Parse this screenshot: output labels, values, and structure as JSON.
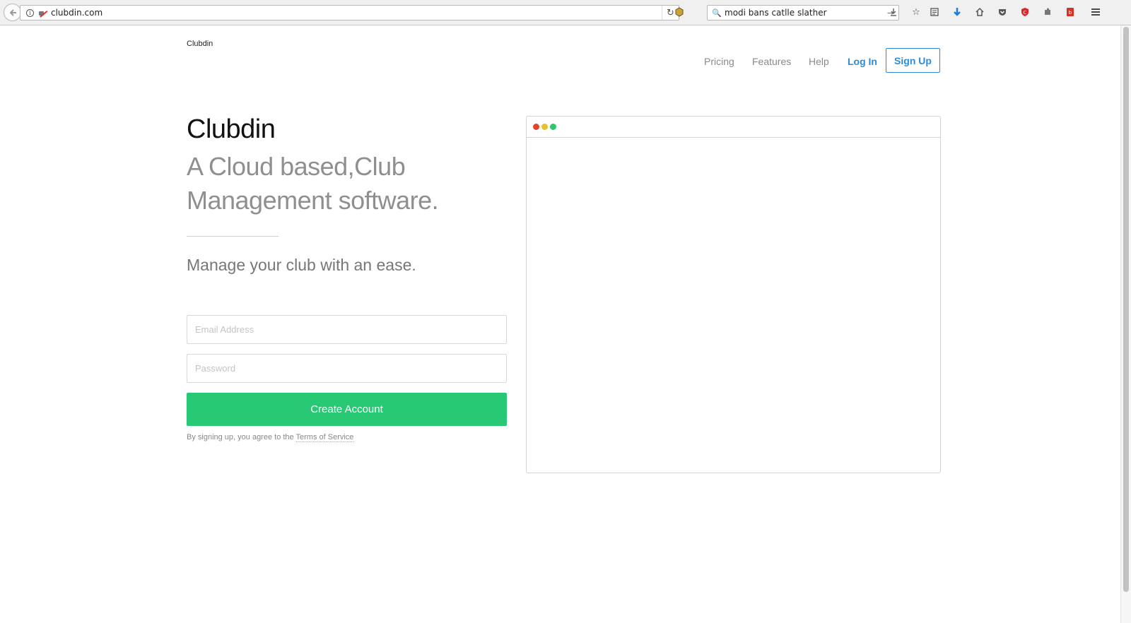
{
  "browser": {
    "url": "clubdin.com",
    "search_query": "modi bans catlle slather",
    "icons": [
      "back-arrow-icon",
      "info-icon",
      "insecure-lock-icon",
      "reload-icon",
      "addon-icon",
      "search-icon",
      "go-arrow-icon",
      "download-icon",
      "bookmark-star-icon",
      "reading-list-icon",
      "download-arrow-icon",
      "home-icon",
      "pocket-icon",
      "adblock-icon",
      "puzzle-icon",
      "pdf-icon",
      "menu-icon"
    ]
  },
  "header": {
    "brand": "Clubdin",
    "nav": {
      "pricing": "Pricing",
      "features": "Features",
      "help": "Help",
      "login": "Log In",
      "signup": "Sign Up"
    }
  },
  "hero": {
    "title": "Clubdin",
    "subtitle": "A Cloud based,Club Management software.",
    "tagline": "Manage your club with an ease."
  },
  "form": {
    "email_placeholder": "Email Address",
    "password_placeholder": "Password",
    "submit_label": "Create Account",
    "terms_prefix": "By signing up, you agree to the ",
    "terms_link": "Terms of Service"
  },
  "colors": {
    "accent_blue": "#2d8bd6",
    "cta_green": "#27c975",
    "dot_red": "#e0452a",
    "dot_yellow": "#e8c02a",
    "dot_green": "#2bc769"
  }
}
